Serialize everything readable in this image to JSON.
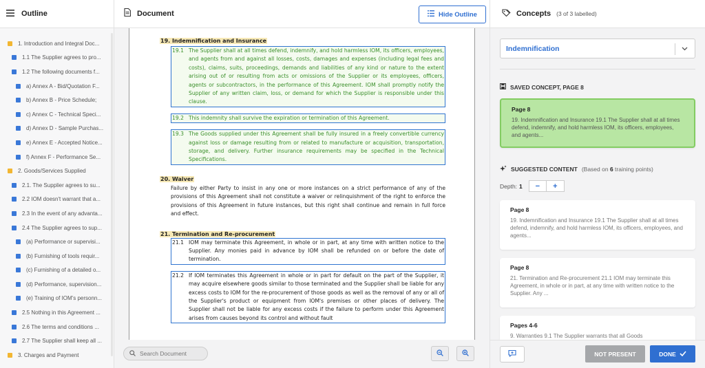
{
  "outline": {
    "title": "Outline",
    "items": [
      {
        "text": "1. Introduction and Integral Doc...",
        "level": 0,
        "color": "yellow"
      },
      {
        "text": "1.1 The Supplier agrees to pro...",
        "level": 1,
        "color": "blue"
      },
      {
        "text": "1.2 The following documents f...",
        "level": 1,
        "color": "blue"
      },
      {
        "text": "a) Annex A - Bid/Quotation F...",
        "level": 2,
        "color": "blue"
      },
      {
        "text": "b) Annex B - Price Schedule;",
        "level": 2,
        "color": "blue"
      },
      {
        "text": "c) Annex C - Technical Speci...",
        "level": 2,
        "color": "blue"
      },
      {
        "text": "d) Annex D - Sample Purchas...",
        "level": 2,
        "color": "blue"
      },
      {
        "text": "e) Annex E - Accepted Notice...",
        "level": 2,
        "color": "blue"
      },
      {
        "text": "f) Annex F - Performance Se...",
        "level": 2,
        "color": "blue"
      },
      {
        "text": "2. Goods/Services Supplied",
        "level": 0,
        "color": "yellow"
      },
      {
        "text": "2.1. The Supplier agrees to su...",
        "level": 1,
        "color": "blue"
      },
      {
        "text": "2.2 IOM doesn't warrant that a...",
        "level": 1,
        "color": "blue"
      },
      {
        "text": "2.3 In the event of any advanta...",
        "level": 1,
        "color": "blue"
      },
      {
        "text": "2.4 The Supplier agrees to sup...",
        "level": 1,
        "color": "blue"
      },
      {
        "text": "(a) Performance or supervisi...",
        "level": 2,
        "color": "blue"
      },
      {
        "text": "(b) Furnishing of tools requir...",
        "level": 2,
        "color": "blue"
      },
      {
        "text": "(c) Furnishing of a detailed o...",
        "level": 2,
        "color": "blue"
      },
      {
        "text": "(d) Performance, supervision...",
        "level": 2,
        "color": "blue"
      },
      {
        "text": "(e) Training of IOM's personn...",
        "level": 2,
        "color": "blue"
      },
      {
        "text": "2.5 Nothing in this Agreement ...",
        "level": 1,
        "color": "blue"
      },
      {
        "text": "2.6 The terms and conditions ...",
        "level": 1,
        "color": "blue"
      },
      {
        "text": "2.7 The Supplier shall keep all ...",
        "level": 1,
        "color": "blue"
      },
      {
        "text": "3. Charges and Payment",
        "level": 0,
        "color": "yellow"
      }
    ]
  },
  "document": {
    "title": "Document",
    "hide_outline_label": "Hide Outline",
    "search_placeholder": "Search Document",
    "sec19_title": "19. Indemnification and Insurance",
    "c191_num": "19.1",
    "c191_text": "The Supplier shall at all times defend, indemnify, and hold harmless IOM, its officers, employees, and agents from and against all losses, costs, damages and expenses (including legal fees and costs), claims, suits, proceedings, demands and liabilities of any kind or nature to the extent arising out of or resulting from acts or omissions of the Supplier or its employees, officers, agents or subcontractors, in the performance of this Agreement. IOM shall promptly notify the Supplier of any written claim, loss, or demand for which the Supplier is responsible under this clause.",
    "c192_num": "19.2",
    "c192_text": "This indemnity shall survive the expiration or termination of this Agreement.",
    "c193_num": "19.3",
    "c193_text": "The Goods supplied under this Agreement shall be fully insured in a freely convertible currency against loss or damage resulting from or related to manufacture or acquisition, transportation, storage, and delivery. Further insurance requirements may be specified in the Technical Specifications.",
    "sec20_title": "20.  Waiver",
    "sec20_text": "Failure by either Party to insist in any one or more instances on a strict performance of any of the provisions of this Agreement shall not constitute a waiver or relinquishment of the right to enforce the provisions of this Agreement in future instances, but this right shall continue and remain in full force and effect.",
    "sec21_title": "21. Termination and Re-procurement",
    "c211_num": "21.1",
    "c211_text": "IOM may terminate this Agreement, in whole or in part, at any time with written notice to the Supplier.  Any monies paid in advance by IOM shall be refunded on or before the date of termination.",
    "c212_num": "21.2",
    "c212_text": "If IOM terminates this Agreement in whole or in part for default on the part of the Supplier, it may acquire elsewhere goods similar to those terminated and the Supplier shall be liable for any excess costs to IOM for the re-procurement of those goods as well as the removal of any or all of the Supplier's product or equipment from IOM's premises or other places of delivery. The Supplier shall not be liable for any excess costs if the failure to perform under this Agreement arises from causes beyond its control and without fault"
  },
  "concepts": {
    "title": "Concepts",
    "count": "(3 of 3 labelled)",
    "selected": "Indemnification",
    "saved_label": "SAVED CONCEPT, PAGE 8",
    "saved_card": {
      "page": "Page 8",
      "snippet": "19. Indemnification and Insurance 19.1 The Supplier shall at all times defend, indemnify, and hold harmless IOM, its officers, employees, and agents..."
    },
    "suggested_label": "SUGGESTED CONTENT",
    "suggested_sub_prefix": "(Based on ",
    "suggested_sub_count": "6",
    "suggested_sub_suffix": " training points)",
    "depth_label": "Depth:",
    "depth_value": "1",
    "minus": "−",
    "plus": "+",
    "suggestions": [
      {
        "page": "Page 8",
        "snippet": "19. Indemnification and Insurance 19.1 The Supplier shall at all times defend, indemnify, and hold harmless IOM, its officers, employees, and agents..."
      },
      {
        "page": "Page 8",
        "snippet": "21. Termination and Re-procurement 21.1 IOM may terminate this Agreement, in whole or in part, at any time with written notice to the Supplier. Any ..."
      },
      {
        "page": "Pages 4-6",
        "snippet": "9. Warranties 9.1 The Supplier warrants that all Goods"
      }
    ],
    "not_present_label": "NOT PRESENT",
    "done_label": "DONE"
  },
  "colors": {
    "accent": "#2f6fd1",
    "saved_green": "#b8e6a3",
    "highlight_text": "#3a8f2a",
    "section_yellow": "#f2b632"
  }
}
